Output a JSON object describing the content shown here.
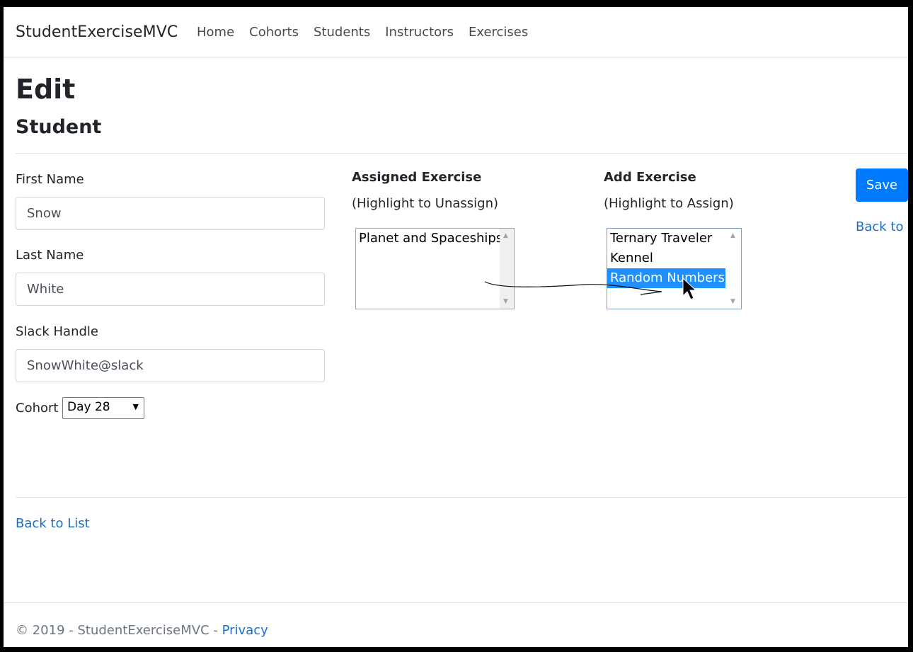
{
  "nav": {
    "brand": "StudentExerciseMVC",
    "links": [
      "Home",
      "Cohorts",
      "Students",
      "Instructors",
      "Exercises"
    ]
  },
  "page": {
    "title": "Edit",
    "subtitle": "Student"
  },
  "form": {
    "first_name": {
      "label": "First Name",
      "value": "Snow"
    },
    "last_name": {
      "label": "Last Name",
      "value": "White"
    },
    "slack_handle": {
      "label": "Slack Handle",
      "value": "SnowWhite@slack"
    },
    "cohort": {
      "label": "Cohort",
      "selected": "Day 28"
    }
  },
  "assigned": {
    "title": "Assigned Exercise",
    "subtitle": "(Highlight to Unassign)",
    "options": [
      "Planet and Spaceships"
    ]
  },
  "add": {
    "title": "Add Exercise",
    "subtitle": "(Highlight to Assign)",
    "options": [
      "Ternary Traveler",
      "Kennel",
      "Random Numbers"
    ],
    "selected_index": 2
  },
  "actions": {
    "save": "Save",
    "back_clipped": "Back to L"
  },
  "back_to_list": "Back to List",
  "footer": {
    "copyright": "© 2019 - StudentExerciseMVC",
    "separator": "-",
    "privacy": "Privacy"
  },
  "colors": {
    "primary": "#007bff",
    "link": "#1b6ec2",
    "selection": "#1e90ff"
  }
}
